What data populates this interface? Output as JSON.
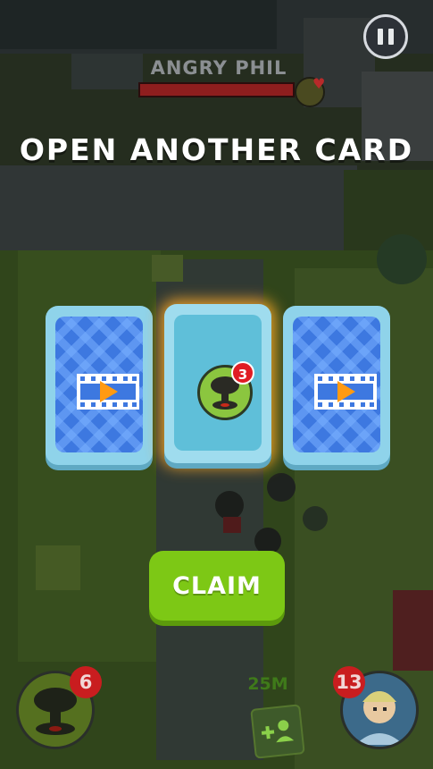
{
  "boss": {
    "name": "ANGRY PHIL",
    "health_fraction": 1.0
  },
  "title": "OPEN ANOTHER CARD",
  "cards": [
    {
      "kind": "watch-video",
      "icon": "video-play-icon"
    },
    {
      "kind": "revealed",
      "icon": "nuke-bomb-icon",
      "badge": "3"
    },
    {
      "kind": "watch-video",
      "icon": "video-play-icon"
    }
  ],
  "claim_label": "CLAIM",
  "abilities": {
    "bomb_count": "6",
    "hero_count": "13"
  },
  "distance": "25M",
  "colors": {
    "claim_green": "#7dc815",
    "card_blue": "#3d78e0",
    "badge_red": "#e01d24",
    "glow_orange": "#ffaa28"
  }
}
